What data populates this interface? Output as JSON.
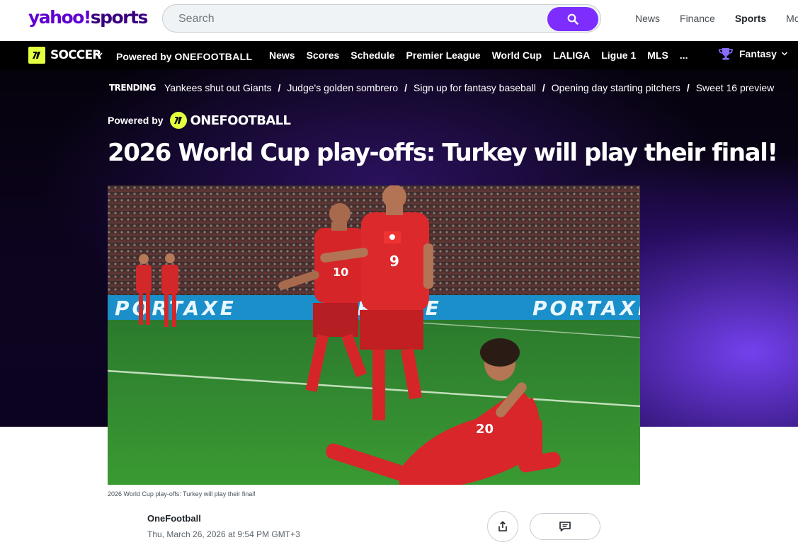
{
  "header": {
    "logo_part1": "yahoo!",
    "logo_part2": "sports",
    "search": {
      "placeholder": "Search",
      "value": ""
    },
    "nav": [
      "News",
      "Finance",
      "Sports",
      "Mo"
    ],
    "active_nav": "Sports",
    "accent_color": "#7d2eff"
  },
  "subnav": {
    "section_title": "SOCCER",
    "powered_prefix": "Powered by",
    "powered_brand": "ONEFOOTBALL",
    "links": [
      "News",
      "Scores",
      "Schedule",
      "Premier League",
      "World Cup",
      "LALIGA",
      "Ligue 1",
      "MLS",
      "..."
    ],
    "fantasy_label": "Fantasy"
  },
  "trending": {
    "label": "TRENDING",
    "items": [
      "Yankees shut out Giants",
      "Judge's golden sombrero",
      "Sign up for fantasy baseball",
      "Opening day starting pitchers",
      "Sweet 16 preview"
    ],
    "separator": "/"
  },
  "article": {
    "powered_prefix": "Powered by",
    "powered_brand": "ONEFOOTBALL",
    "headline": "2026 World Cup play-offs: Turkey will play their final!",
    "image_alt": "Turkey players celebrating a goal",
    "board_text": "PORTAXE",
    "jersey_numbers": [
      "10",
      "9",
      "20"
    ],
    "caption": "2026 World Cup play-offs: Turkey will play their final!",
    "author": "OneFootball",
    "date": "Thu, March 26, 2026 at 9:54 PM GMT+3"
  },
  "icons": {
    "search": "search-icon",
    "share": "share-icon",
    "comment": "comment-icon",
    "trophy": "trophy-icon",
    "chevron": "chevron-down-icon"
  }
}
